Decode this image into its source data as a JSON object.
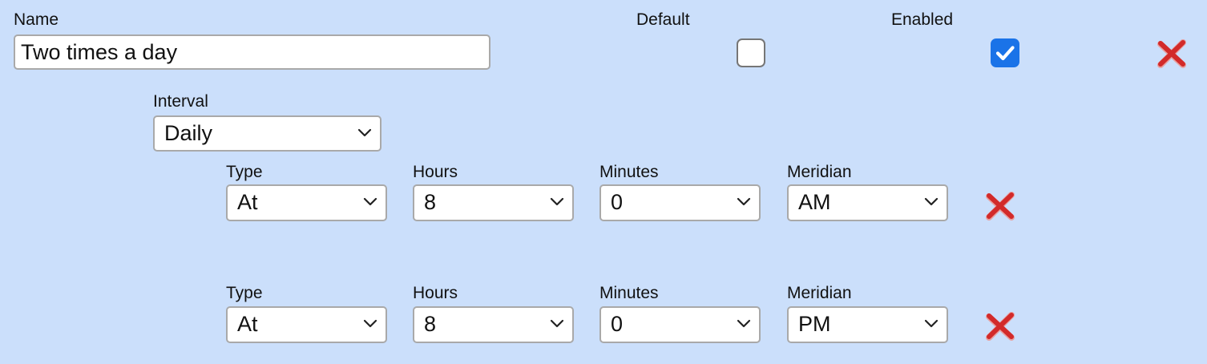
{
  "schedule": {
    "name_label": "Name",
    "name_value": "Two times a day",
    "default_label": "Default",
    "default_checked": false,
    "enabled_label": "Enabled",
    "enabled_checked": true,
    "interval_label": "Interval",
    "interval_value": "Daily",
    "times": [
      {
        "type_label": "Type",
        "type_value": "At",
        "hours_label": "Hours",
        "hours_value": "8",
        "minutes_label": "Minutes",
        "minutes_value": "0",
        "meridian_label": "Meridian",
        "meridian_value": "AM"
      },
      {
        "type_label": "Type",
        "type_value": "At",
        "hours_label": "Hours",
        "hours_value": "8",
        "minutes_label": "Minutes",
        "minutes_value": "0",
        "meridian_label": "Meridian",
        "meridian_value": "PM"
      }
    ]
  },
  "icons": {
    "delete_schedule": "close-x-icon",
    "delete_time": "close-x-icon",
    "dropdown": "chevron-down-icon",
    "check": "checkmark-icon"
  },
  "colors": {
    "background": "#cbdffb",
    "checkbox_on": "#1a73e8",
    "delete_red": "#d22a2a"
  }
}
